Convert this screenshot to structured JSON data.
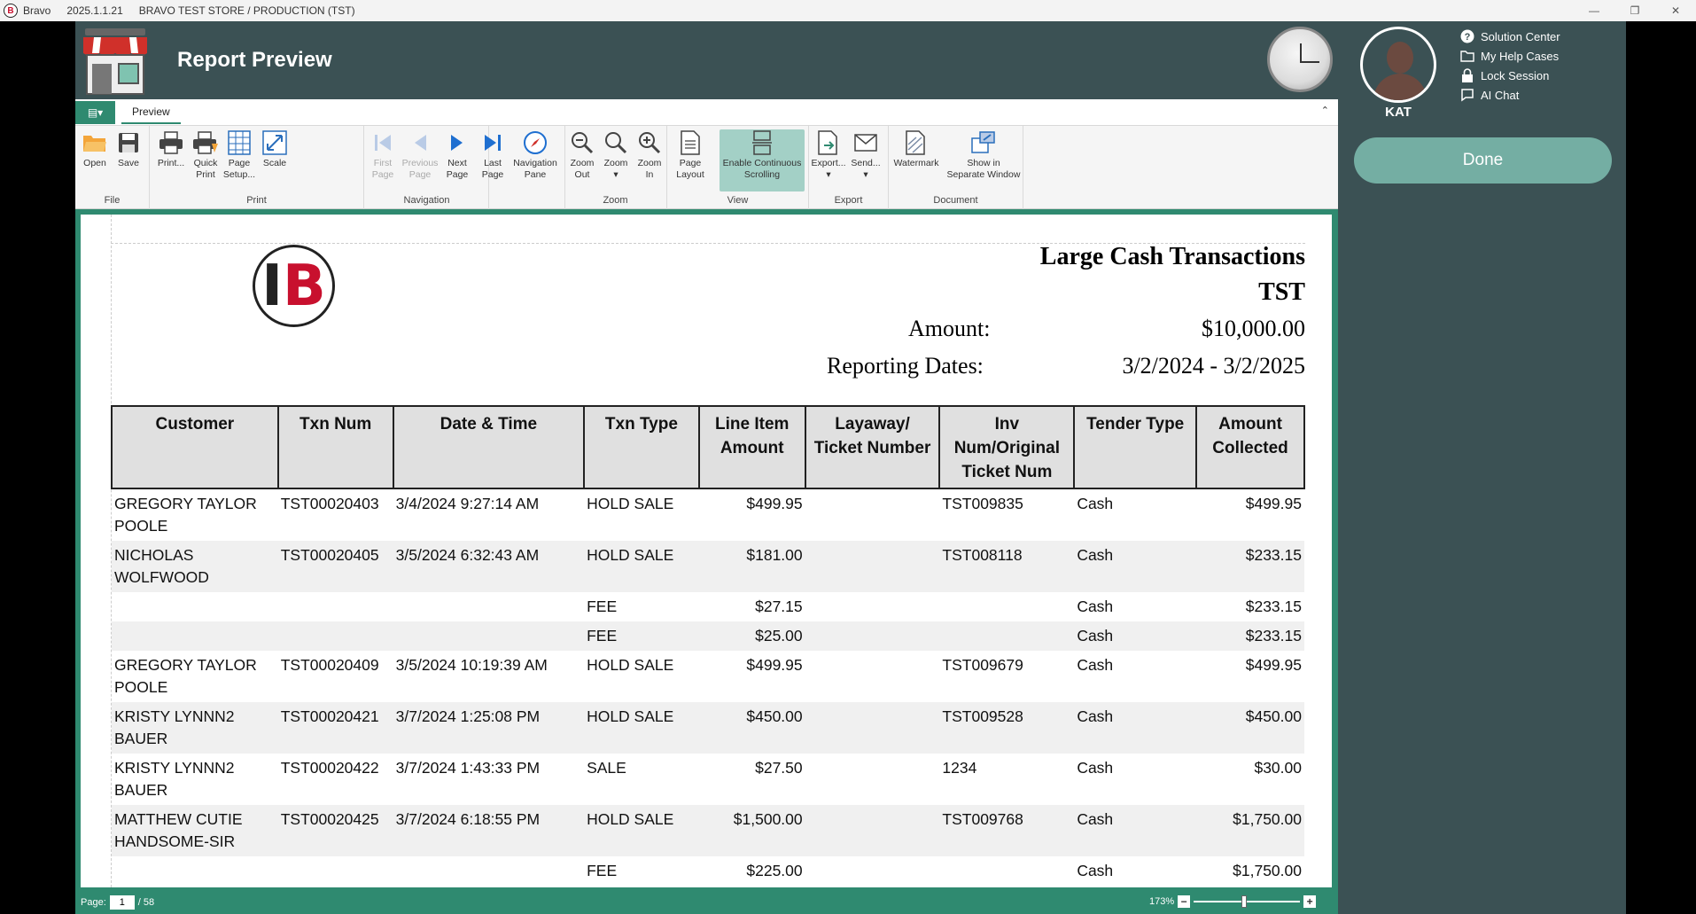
{
  "titlebar": {
    "app_name": "Bravo",
    "version": "2025.1.1.21",
    "store": "BRAVO TEST STORE / PRODUCTION (TST)"
  },
  "header": {
    "page_title": "Report Preview",
    "user_name": "KAT",
    "help_links": [
      "Solution Center",
      "My Help Cases",
      "Lock Session",
      "AI Chat"
    ],
    "done_label": "Done"
  },
  "ribbon": {
    "tab": "Preview",
    "groups": {
      "file": "File",
      "print": "Print",
      "navigation": "Navigation",
      "zoom": "Zoom",
      "view": "View",
      "export": "Export",
      "document": "Document"
    },
    "buttons": {
      "open": "Open",
      "save": "Save",
      "print": "Print...",
      "quick_print": "Quick\nPrint",
      "page_setup": "Page\nSetup...",
      "scale": "Scale",
      "first_page": "First\nPage",
      "previous_page": "Previous\nPage",
      "next_page": "Next\nPage",
      "last_page": "Last\nPage",
      "navigation_pane": "Navigation\nPane",
      "zoom_out": "Zoom\nOut",
      "zoom": "Zoom",
      "zoom_in": "Zoom\nIn",
      "page_layout": "Page\nLayout",
      "continuous_scrolling": "Enable Continuous\nScrolling",
      "export": "Export...",
      "send": "Send...",
      "watermark": "Watermark",
      "separate_window": "Show in\nSeparate Window"
    }
  },
  "report": {
    "title": "Large Cash Transactions",
    "store": "TST",
    "amount_label": "Amount:",
    "amount_value": "$10,000.00",
    "dates_label": "Reporting Dates:",
    "dates_value": "3/2/2024 - 3/2/2025",
    "columns": [
      "Customer",
      "Txn Num",
      "Date & Time",
      "Txn Type",
      "Line Item Amount",
      "Layaway/ Ticket Number",
      "Inv Num/Original Ticket Num",
      "Tender Type",
      "Amount Collected"
    ],
    "rows": [
      {
        "customer": "GREGORY TAYLOR POOLE",
        "txn": "TST00020403",
        "date": "3/4/2024 9:27:14 AM",
        "type": "HOLD SALE",
        "line": "$499.95",
        "layaway": "",
        "inv": "TST009835",
        "tender": "Cash",
        "collected": "$499.95"
      },
      {
        "customer": "NICHOLAS WOLFWOOD",
        "txn": "TST00020405",
        "date": "3/5/2024 6:32:43 AM",
        "type": "HOLD SALE",
        "line": "$181.00",
        "layaway": "",
        "inv": "TST008118",
        "tender": "Cash",
        "collected": "$233.15"
      },
      {
        "customer": "",
        "txn": "",
        "date": "",
        "type": "FEE",
        "line": "$27.15",
        "layaway": "",
        "inv": "",
        "tender": "Cash",
        "collected": "$233.15"
      },
      {
        "customer": "",
        "txn": "",
        "date": "",
        "type": "FEE",
        "line": "$25.00",
        "layaway": "",
        "inv": "",
        "tender": "Cash",
        "collected": "$233.15"
      },
      {
        "customer": "GREGORY TAYLOR POOLE",
        "txn": "TST00020409",
        "date": "3/5/2024 10:19:39 AM",
        "type": "HOLD SALE",
        "line": "$499.95",
        "layaway": "",
        "inv": "TST009679",
        "tender": "Cash",
        "collected": "$499.95"
      },
      {
        "customer": "KRISTY LYNNN2 BAUER",
        "txn": "TST00020421",
        "date": "3/7/2024 1:25:08 PM",
        "type": "HOLD SALE",
        "line": "$450.00",
        "layaway": "",
        "inv": "TST009528",
        "tender": "Cash",
        "collected": "$450.00"
      },
      {
        "customer": "KRISTY LYNNN2 BAUER",
        "txn": "TST00020422",
        "date": "3/7/2024 1:43:33 PM",
        "type": "SALE",
        "line": "$27.50",
        "layaway": "",
        "inv": "1234",
        "tender": "Cash",
        "collected": "$30.00"
      },
      {
        "customer": "MATTHEW CUTIE HANDSOME-SIR",
        "txn": "TST00020425",
        "date": "3/7/2024 6:18:55 PM",
        "type": "HOLD SALE",
        "line": "$1,500.00",
        "layaway": "",
        "inv": "TST009768",
        "tender": "Cash",
        "collected": "$1,750.00"
      },
      {
        "customer": "",
        "txn": "",
        "date": "",
        "type": "FEE",
        "line": "$225.00",
        "layaway": "",
        "inv": "",
        "tender": "Cash",
        "collected": "$1,750.00"
      }
    ]
  },
  "status": {
    "page_label": "Page:",
    "page_current": "1",
    "page_total": "/ 58",
    "zoom_level": "173%",
    "zoom_slider_fraction": 0.47
  },
  "colors": {
    "app_bg": "#3b5154",
    "accent": "#2f8a70",
    "done_button": "#74aea3",
    "brand_red": "#c8102e"
  }
}
